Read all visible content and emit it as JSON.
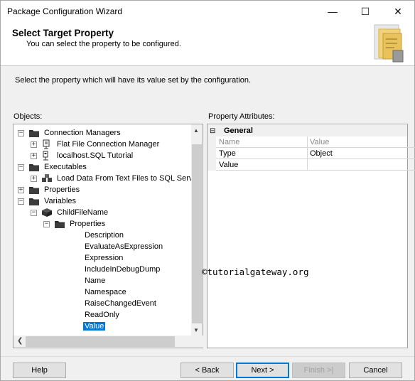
{
  "window": {
    "title": "Package Configuration Wizard",
    "minimize_glyph": "—",
    "maximize_glyph": "☐",
    "close_glyph": "✕"
  },
  "header": {
    "title": "Select Target Property",
    "subtitle": "You can select the property to be configured."
  },
  "instruction": "Select the property which will have its value set by the configuration.",
  "objects_label": "Objects:",
  "tree": [
    {
      "label": "Connection Managers",
      "expander": "⊟",
      "icon": "folder-icon"
    },
    {
      "label": "Flat File Connection Manager",
      "expander": "⊞",
      "icon": "flat-file-icon"
    },
    {
      "label": "localhost.SQL Tutorial",
      "expander": "⊞",
      "icon": "database-connection-icon"
    },
    {
      "label": "Executables",
      "expander": "⊟",
      "icon": "folder-icon"
    },
    {
      "label": "Load Data From Text Files to SQL Serve",
      "expander": "⊞",
      "icon": "data-flow-task-icon"
    },
    {
      "label": "Properties",
      "expander": "⊞",
      "icon": "folder-icon"
    },
    {
      "label": "Variables",
      "expander": "⊟",
      "icon": "folder-icon"
    },
    {
      "label": "ChildFileName",
      "expander": "⊟",
      "icon": "variable-icon"
    },
    {
      "label": "Properties",
      "expander": "⊟",
      "icon": "folder-icon"
    },
    {
      "label": "Description"
    },
    {
      "label": "EvaluateAsExpression"
    },
    {
      "label": "Expression"
    },
    {
      "label": "IncludeInDebugDump"
    },
    {
      "label": "Name"
    },
    {
      "label": "Namespace"
    },
    {
      "label": "RaiseChangedEvent"
    },
    {
      "label": "ReadOnly"
    },
    {
      "label": "Value",
      "selected": true
    }
  ],
  "property_attributes_label": "Property Attributes:",
  "grid": {
    "category": "General",
    "collapse_glyph": "⊟",
    "rows": [
      {
        "name": "Name",
        "value": "Value",
        "grayed": true
      },
      {
        "name": "Type",
        "value": "Object",
        "grayed": false
      },
      {
        "name": "Value",
        "value": "",
        "grayed": false
      }
    ]
  },
  "watermark": "©tutorialgateway.org",
  "buttons": {
    "help": "Help",
    "back": "< Back",
    "next": "Next >",
    "finish": "Finish >|",
    "cancel": "Cancel"
  },
  "colors": {
    "selection": "#0078d7",
    "folder": "#2b2b2b"
  }
}
